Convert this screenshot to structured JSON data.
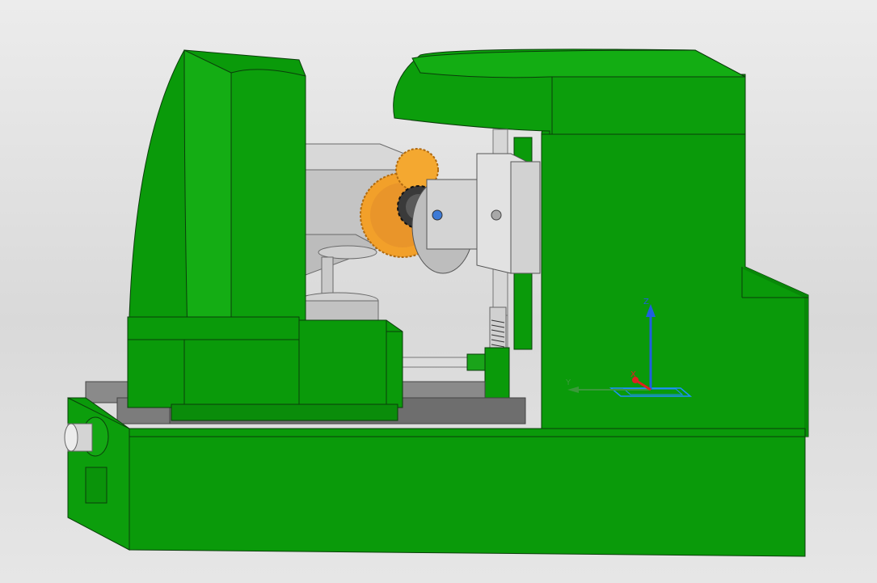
{
  "viewport": {
    "background_top": "#ececec",
    "background_bottom": "#e6e6e6"
  },
  "colors": {
    "machine_green": "#0a9a0a",
    "machine_green_light": "#18b418",
    "machine_green_dark": "#057a05",
    "outline": "#0b3d0b",
    "steel_gray": "#c8c8c8",
    "steel_gray_dark": "#8a8a8a",
    "rail_gray": "#6e6e6e",
    "gear_orange": "#f2a02a",
    "gear_dark": "#333333"
  },
  "triad": {
    "axis_z": "Z",
    "axis_y": "Y",
    "axis_x": "X",
    "color_z": "#1f5fe0",
    "color_y": "#3a9a3a",
    "color_x": "#e02020",
    "plane_color": "#1e90ff"
  },
  "icons": {
    "coordinate_triad": "csys-triad-icon"
  }
}
